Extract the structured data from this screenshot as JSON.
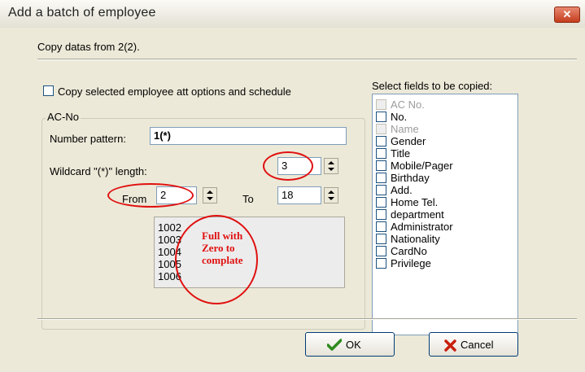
{
  "window": {
    "title": "Add a batch of employee",
    "close_glyph": "✕"
  },
  "header": {
    "copy_from_text": "Copy datas from 2(2)."
  },
  "options": {
    "copy_att_label": "Copy selected employee att options and schedule"
  },
  "acno": {
    "group_title": "AC-No",
    "number_pattern_label": "Number pattern:",
    "number_pattern_value": "1(*)",
    "wildcard_label": "Wildcard \"(*)\" length:",
    "wildcard_value": "3",
    "from_label": "From",
    "from_value": "2",
    "to_label": "To",
    "to_value": "18",
    "preview": [
      "1002",
      "1003",
      "1004",
      "1005",
      "1006"
    ]
  },
  "annotation": {
    "lines": [
      "Full with",
      "Zero to",
      "complate"
    ]
  },
  "fields": {
    "title": "Select fields to be copied:",
    "items": [
      {
        "label": "AC No.",
        "enabled": false
      },
      {
        "label": "No.",
        "enabled": true
      },
      {
        "label": "Name",
        "enabled": false
      },
      {
        "label": "Gender",
        "enabled": true
      },
      {
        "label": "Title",
        "enabled": true
      },
      {
        "label": "Mobile/Pager",
        "enabled": true
      },
      {
        "label": "Birthday",
        "enabled": true
      },
      {
        "label": "Add.",
        "enabled": true
      },
      {
        "label": "Home Tel.",
        "enabled": true
      },
      {
        "label": "department",
        "enabled": true
      },
      {
        "label": "Administrator",
        "enabled": true
      },
      {
        "label": "Nationality",
        "enabled": true
      },
      {
        "label": "CardNo",
        "enabled": true
      },
      {
        "label": "Privilege",
        "enabled": true
      }
    ]
  },
  "buttons": {
    "ok_label": "OK",
    "cancel_label": "Cancel",
    "ok_icon": "checkmark-icon",
    "cancel_icon": "x-icon"
  },
  "colors": {
    "annotation": "#e01010",
    "ok_check": "#2e8b1e",
    "cancel_x": "#c8200c"
  }
}
